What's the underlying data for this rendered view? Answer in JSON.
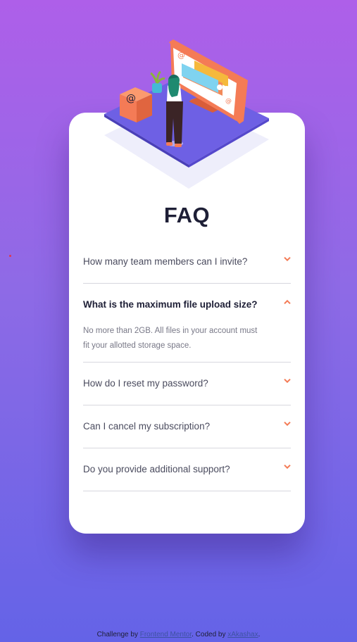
{
  "page": {
    "title": "FAQ"
  },
  "colors": {
    "accent": "#f47b56",
    "heading": "#1e1f36",
    "text": "#4a4b5e",
    "answer": "#787887",
    "divider": "#d7d7de",
    "bg_top": "#ae5fe9",
    "bg_bottom": "#6463e7"
  },
  "faq": [
    {
      "question": "How many team members can I invite?",
      "open": false,
      "icon": "chevron-down-icon"
    },
    {
      "question": "What is the maximum file upload size?",
      "answer": "No more than 2GB. All files in your account must fit your allotted storage space.",
      "open": true,
      "icon": "chevron-up-icon"
    },
    {
      "question": "How do I reset my password?",
      "open": false,
      "icon": "chevron-down-icon"
    },
    {
      "question": "Can I cancel my subscription?",
      "open": false,
      "icon": "chevron-down-icon"
    },
    {
      "question": "Do you provide additional support?",
      "open": false,
      "icon": "chevron-down-icon"
    }
  ],
  "footer": {
    "prefix": "Challenge by ",
    "link1": "Frontend Mentor",
    "middle": ". Coded by ",
    "link2": "xAkashax",
    "suffix": "."
  }
}
